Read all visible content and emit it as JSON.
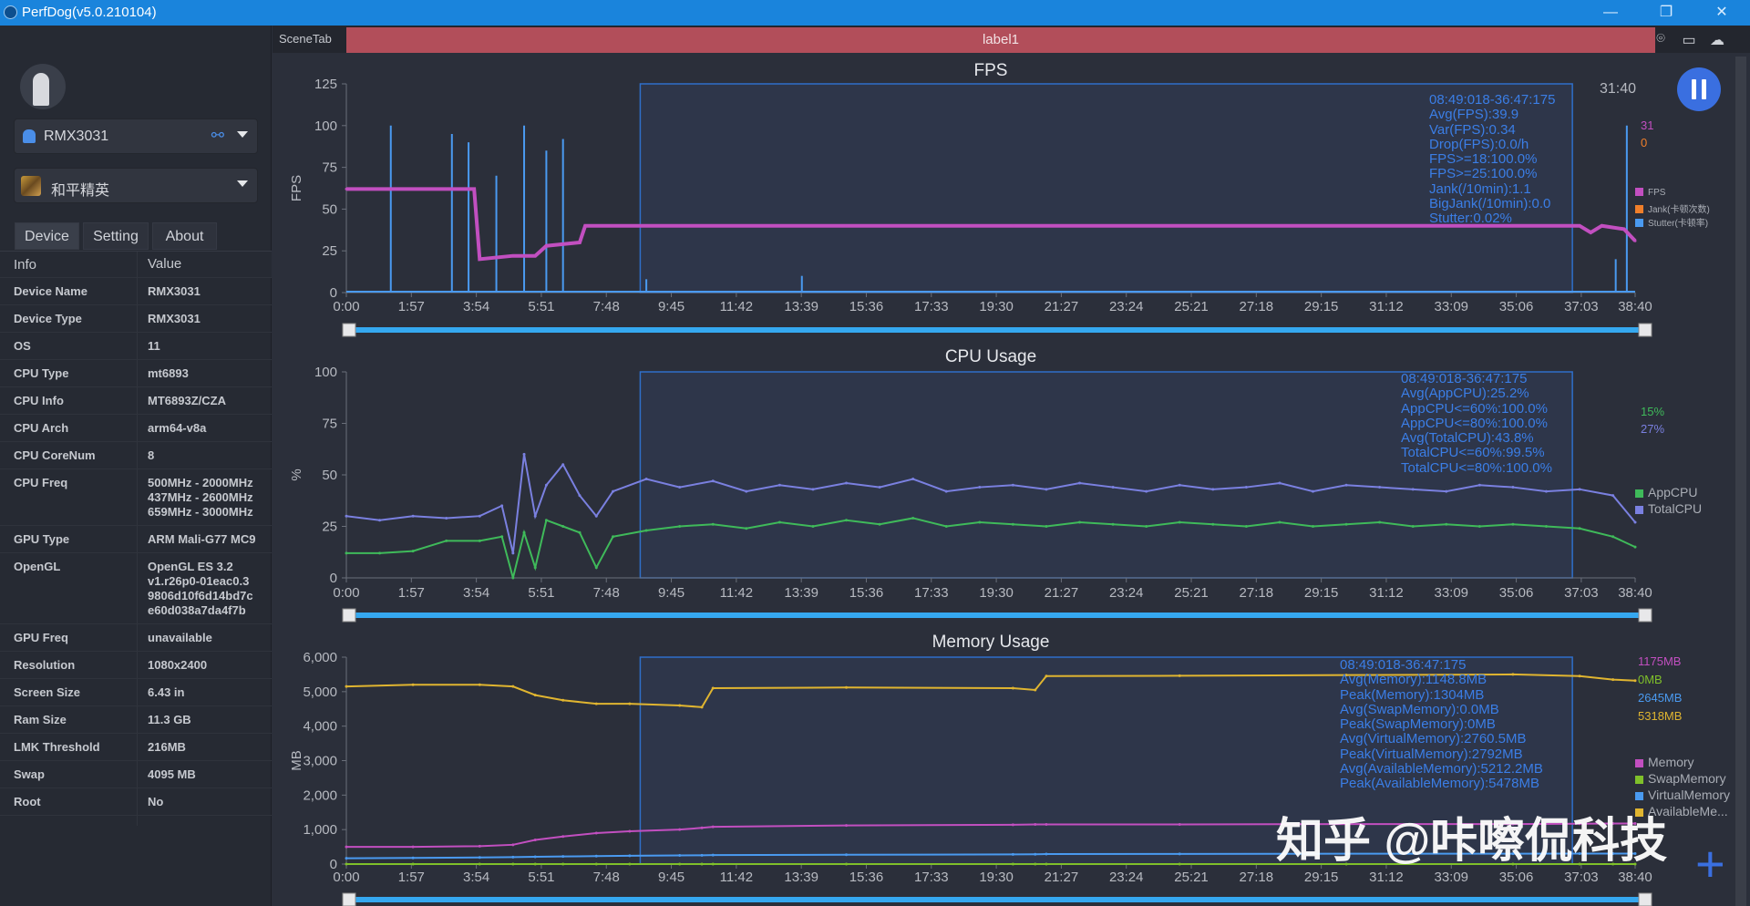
{
  "window": {
    "title": "PerfDog(v5.0.210104)",
    "controls": [
      "minimize",
      "maximize",
      "close"
    ]
  },
  "sidebar": {
    "device": {
      "name": "RMX3031",
      "icon": "android-icon"
    },
    "app": {
      "name": "和平精英"
    },
    "tabs": [
      {
        "label": "Device",
        "selected": true
      },
      {
        "label": "Setting"
      },
      {
        "label": "About"
      }
    ],
    "table_header": {
      "info": "Info",
      "value": "Value"
    },
    "rows": [
      {
        "k": "Device Name",
        "v": "RMX3031"
      },
      {
        "k": "Device Type",
        "v": "RMX3031"
      },
      {
        "k": "OS",
        "v": "11"
      },
      {
        "k": "CPU Type",
        "v": "mt6893"
      },
      {
        "k": "CPU Info",
        "v": "MT6893Z/CZA"
      },
      {
        "k": "CPU Arch",
        "v": "arm64-v8a"
      },
      {
        "k": "CPU CoreNum",
        "v": "8"
      },
      {
        "k": "CPU Freq",
        "v": "500MHz - 2000MHz\n437MHz - 2600MHz\n659MHz - 3000MHz"
      },
      {
        "k": "GPU Type",
        "v": "ARM Mali-G77 MC9"
      },
      {
        "k": "OpenGL",
        "v": "OpenGL ES 3.2\nv1.r26p0-01eac0.3\n9806d10f6d14bd7c\ne60d038a7da4f7b"
      },
      {
        "k": "GPU Freq",
        "v": "unavailable"
      },
      {
        "k": "Resolution",
        "v": "1080x2400"
      },
      {
        "k": "Screen Size",
        "v": "6.43 in"
      },
      {
        "k": "Ram Size",
        "v": "11.3 GB"
      },
      {
        "k": "LMK Threshold",
        "v": "216MB"
      },
      {
        "k": "Swap",
        "v": "4095 MB"
      },
      {
        "k": "Root",
        "v": "No"
      }
    ]
  },
  "scene": {
    "tab": "SceneTab",
    "label": "label1",
    "icons": [
      "location-icon",
      "folder-icon",
      "cloud-icon"
    ]
  },
  "timer": "31:40",
  "watermark": "知乎 @咔嚓侃科技",
  "colors": {
    "accent": "#3a6fe0",
    "label_bar": "#b24e5a",
    "fps": "#c24fc0",
    "jank": "#f07f2a",
    "stutter": "#4a9af0",
    "appcpu": "#3fba5a",
    "totalcpu": "#7a80e0",
    "memory": "#c24fc0",
    "swap": "#7fc02a",
    "virtual": "#4a9af0",
    "available": "#e0b530",
    "stats": "#3b7ee6"
  },
  "chart_data": [
    {
      "type": "line",
      "title": "FPS",
      "ylabel": "FPS",
      "ylim": [
        0,
        125
      ],
      "yticks": [
        0,
        25,
        50,
        75,
        100,
        125
      ],
      "xlim": [
        "0:00",
        "38:40"
      ],
      "xticks": [
        "0:00",
        "1:57",
        "3:54",
        "5:51",
        "7:48",
        "9:45",
        "11:42",
        "13:39",
        "15:36",
        "17:33",
        "19:30",
        "21:27",
        "23:24",
        "25:21",
        "27:18",
        "29:15",
        "31:12",
        "33:09",
        "35:06",
        "37:03",
        "38:40"
      ],
      "selection": [
        "8:49",
        "36:47"
      ],
      "stats": [
        "08:49:018-36:47:175",
        "Avg(FPS):39.9",
        "Var(FPS):0.34",
        "Drop(FPS):0.0/h",
        "FPS>=18:100.0%",
        "FPS>=25:100.0%",
        "Jank(/10min):1.1",
        "BigJank(/10min):0.0",
        "Stutter:0.02%"
      ],
      "current": [
        {
          "v": "31",
          "color": "#c24fc0"
        },
        {
          "v": "0",
          "color": "#f07f2a"
        }
      ],
      "legend": [
        {
          "name": "FPS",
          "color": "#c24fc0"
        },
        {
          "name": "Jank(卡顿次数)",
          "color": "#f07f2a"
        },
        {
          "name": "Stutter(卡顿率)",
          "color": "#4a9af0"
        }
      ],
      "x": [
        "0:00",
        "1:00",
        "2:00",
        "3:00",
        "3:50",
        "4:00",
        "5:00",
        "5:40",
        "6:00",
        "7:00",
        "7:10",
        "8:00",
        "10:00",
        "15:00",
        "20:00",
        "25:00",
        "30:00",
        "35:00",
        "37:00",
        "37:20",
        "37:40",
        "38:20",
        "38:40"
      ],
      "series": [
        {
          "name": "FPS",
          "color": "#c24fc0",
          "values": [
            62,
            62,
            62,
            62,
            62,
            20,
            22,
            22,
            28,
            30,
            40,
            40,
            40,
            40,
            40,
            40,
            40,
            40,
            40,
            36,
            40,
            38,
            31
          ]
        }
      ],
      "stutter_spikes": [
        [
          "1:20",
          100
        ],
        [
          "3:10",
          95
        ],
        [
          "3:40",
          90
        ],
        [
          "4:30",
          70
        ],
        [
          "5:20",
          100
        ],
        [
          "6:00",
          85
        ],
        [
          "6:30",
          92
        ],
        [
          "9:00",
          8
        ],
        [
          "13:40",
          10
        ],
        [
          "38:05",
          20
        ],
        [
          "38:25",
          100
        ]
      ]
    },
    {
      "type": "line",
      "title": "CPU Usage",
      "ylabel": "%",
      "ylim": [
        0,
        100
      ],
      "yticks": [
        0,
        25,
        50,
        75,
        100
      ],
      "xlim": [
        "0:00",
        "38:40"
      ],
      "selection": [
        "8:49",
        "36:47"
      ],
      "stats": [
        "08:49:018-36:47:175",
        "Avg(AppCPU):25.2%",
        "AppCPU<=60%:100.0%",
        "AppCPU<=80%:100.0%",
        "Avg(TotalCPU):43.8%",
        "TotalCPU<=60%:99.5%",
        "TotalCPU<=80%:100.0%"
      ],
      "current": [
        {
          "v": "15%",
          "color": "#3fba5a"
        },
        {
          "v": "27%",
          "color": "#7a80e0"
        }
      ],
      "legend": [
        {
          "name": "AppCPU",
          "color": "#3fba5a"
        },
        {
          "name": "TotalCPU",
          "color": "#7a80e0"
        }
      ],
      "x": [
        "0:00",
        "1:00",
        "2:00",
        "3:00",
        "4:00",
        "4:40",
        "5:00",
        "5:20",
        "5:40",
        "6:00",
        "6:30",
        "7:00",
        "7:30",
        "8:00",
        "9:00",
        "10:00",
        "11:00",
        "12:00",
        "13:00",
        "14:00",
        "15:00",
        "16:00",
        "17:00",
        "18:00",
        "19:00",
        "20:00",
        "21:00",
        "22:00",
        "23:00",
        "24:00",
        "25:00",
        "26:00",
        "27:00",
        "28:00",
        "29:00",
        "30:00",
        "31:00",
        "32:00",
        "33:00",
        "34:00",
        "35:00",
        "36:00",
        "37:00",
        "38:00",
        "38:40"
      ],
      "series": [
        {
          "name": "TotalCPU",
          "color": "#7a80e0",
          "values": [
            30,
            28,
            30,
            29,
            30,
            35,
            12,
            60,
            30,
            45,
            55,
            40,
            30,
            42,
            48,
            44,
            47,
            42,
            45,
            43,
            46,
            44,
            48,
            42,
            44,
            45,
            43,
            46,
            44,
            42,
            45,
            43,
            44,
            46,
            42,
            45,
            44,
            43,
            42,
            45,
            44,
            42,
            43,
            40,
            27
          ]
        },
        {
          "name": "AppCPU",
          "color": "#3fba5a",
          "values": [
            12,
            12,
            13,
            18,
            18,
            20,
            0,
            22,
            5,
            28,
            25,
            22,
            5,
            20,
            23,
            25,
            26,
            24,
            27,
            25,
            28,
            26,
            29,
            25,
            27,
            26,
            25,
            27,
            26,
            25,
            27,
            26,
            25,
            27,
            25,
            26,
            27,
            25,
            26,
            25,
            26,
            25,
            24,
            20,
            15
          ]
        }
      ]
    },
    {
      "type": "line",
      "title": "Memory Usage",
      "ylabel": "MB",
      "ylim": [
        0,
        6000
      ],
      "yticks": [
        0,
        1000,
        2000,
        3000,
        4000,
        5000,
        6000
      ],
      "ytick_labels": [
        "0",
        "1,000",
        "2,000",
        "3,000",
        "4,000",
        "5,000",
        "6,000"
      ],
      "xlim": [
        "0:00",
        "38:40"
      ],
      "selection": [
        "8:49",
        "36:47"
      ],
      "stats": [
        "08:49:018-36:47:175",
        "Avg(Memory):1148.8MB",
        "Peak(Memory):1304MB",
        "Avg(SwapMemory):0.0MB",
        "Peak(SwapMemory):0MB",
        "Avg(VirtualMemory):2760.5MB",
        "Peak(VirtualMemory):2792MB",
        "Avg(AvailableMemory):5212.2MB",
        "Peak(AvailableMemory):5478MB"
      ],
      "current": [
        {
          "v": "1175MB",
          "color": "#c24fc0"
        },
        {
          "v": "0MB",
          "color": "#7fc02a"
        },
        {
          "v": "2645MB",
          "color": "#4a9af0"
        },
        {
          "v": "5318MB",
          "color": "#e0b530"
        }
      ],
      "legend": [
        {
          "name": "Memory",
          "color": "#c24fc0"
        },
        {
          "name": "SwapMemory",
          "color": "#7fc02a"
        },
        {
          "name": "VirtualMemory",
          "color": "#4a9af0"
        },
        {
          "name": "AvailableMe...",
          "color": "#e0b530"
        }
      ],
      "x": [
        "0:00",
        "2:00",
        "4:00",
        "5:00",
        "5:40",
        "6:30",
        "7:30",
        "8:30",
        "10:00",
        "10:40",
        "11:00",
        "15:00",
        "20:00",
        "20:40",
        "21:00",
        "25:00",
        "30:00",
        "35:00",
        "37:00",
        "38:00",
        "38:40"
      ],
      "series": [
        {
          "name": "Memory",
          "color": "#c24fc0",
          "values": [
            500,
            500,
            520,
            560,
            700,
            800,
            900,
            950,
            1000,
            1050,
            1080,
            1120,
            1140,
            1150,
            1150,
            1150,
            1160,
            1160,
            1170,
            1175,
            1175
          ]
        },
        {
          "name": "SwapMemory",
          "color": "#7fc02a",
          "values": [
            0,
            0,
            0,
            0,
            0,
            0,
            0,
            0,
            0,
            0,
            0,
            0,
            0,
            0,
            0,
            0,
            0,
            0,
            0,
            0,
            0
          ]
        },
        {
          "name": "VirtualMemory",
          "color": "#4a9af0",
          "values": [
            170,
            180,
            190,
            200,
            210,
            220,
            230,
            240,
            250,
            255,
            260,
            270,
            280,
            285,
            290,
            295,
            300,
            300,
            305,
            305,
            305
          ]
        },
        {
          "name": "AvailableMemory",
          "color": "#e0b530",
          "values": [
            5150,
            5200,
            5200,
            5150,
            4900,
            4750,
            4650,
            4650,
            4600,
            4550,
            5100,
            5120,
            5100,
            5050,
            5450,
            5460,
            5480,
            5500,
            5450,
            5350,
            5318
          ]
        }
      ]
    }
  ]
}
